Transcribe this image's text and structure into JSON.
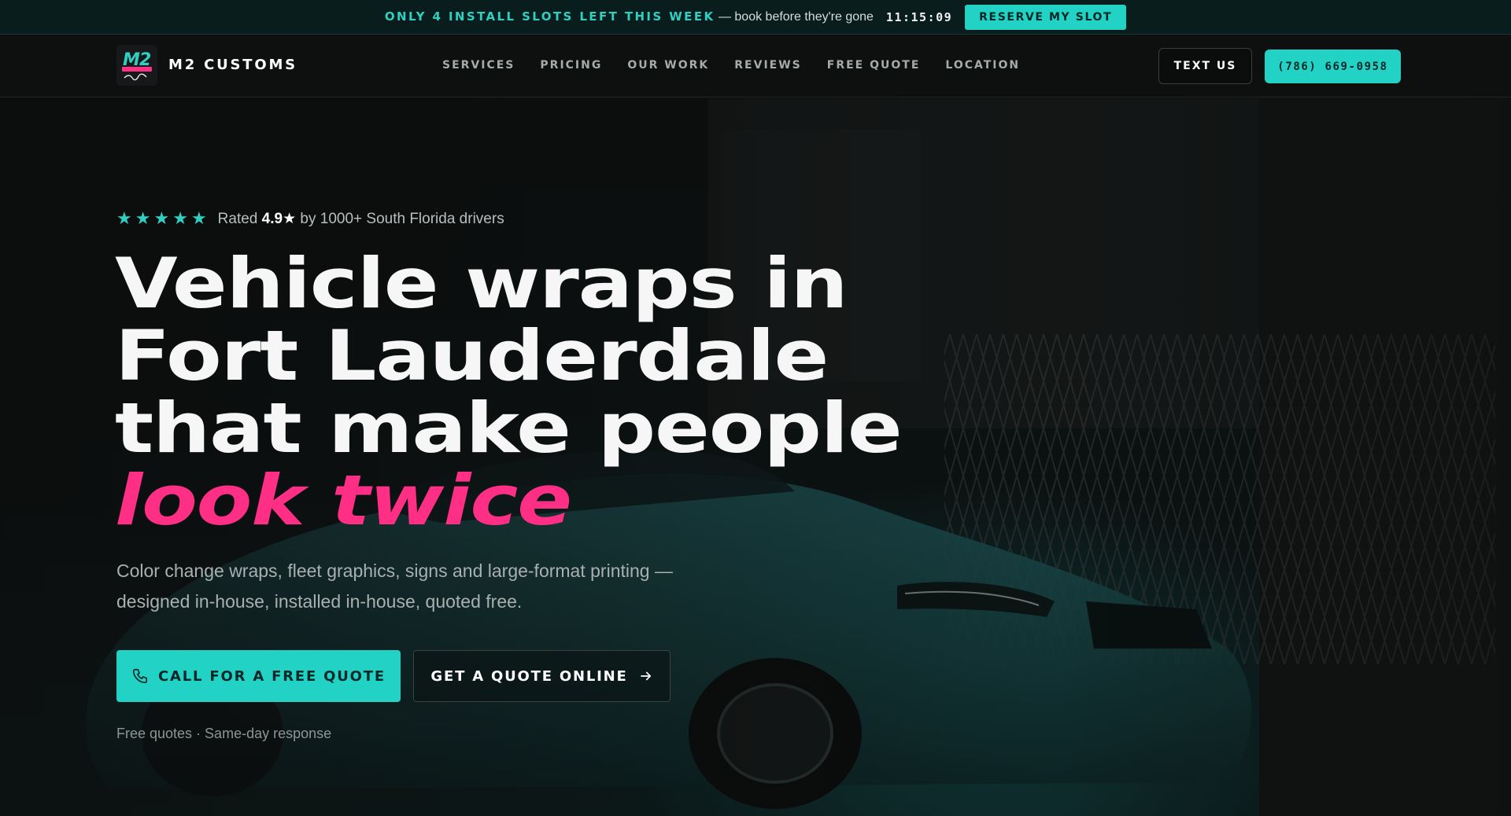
{
  "promo": {
    "headline": "ONLY 4 INSTALL SLOTS LEFT THIS WEEK",
    "subtext": "— book before they're gone",
    "timer": "11:15:09",
    "button_label": "RESERVE MY SLOT"
  },
  "header": {
    "brand": "M2 CUSTOMS",
    "logo_icon": "m2-customs-logo",
    "nav": [
      {
        "label": "SERVICES"
      },
      {
        "label": "PRICING"
      },
      {
        "label": "OUR WORK"
      },
      {
        "label": "REVIEWS"
      },
      {
        "label": "FREE QUOTE"
      },
      {
        "label": "LOCATION"
      }
    ],
    "text_us_label": "TEXT US",
    "phone_label": "(786) 669-0958"
  },
  "hero": {
    "rating": {
      "stars": 5,
      "prefix": "Rated",
      "score": "4.9",
      "score_star": "★",
      "suffix": "by 1000+ South Florida drivers"
    },
    "headline_lines": [
      "Vehicle wraps in",
      "Fort Lauderdale",
      "that make people"
    ],
    "headline_accent": "look twice",
    "subcopy": "Color change wraps, fleet graphics, signs and large-format printing — designed in-house, installed in-house, quoted free.",
    "cta_primary": {
      "label": "CALL FOR A FREE QUOTE",
      "icon": "phone-icon"
    },
    "cta_secondary": {
      "label": "GET A QUOTE ONLINE",
      "icon": "arrow-right-icon"
    },
    "footnote": "Free quotes · Same-day response"
  },
  "colors": {
    "accent": "#22d3c5",
    "highlight": "#ff2f86",
    "background": "#0c0d0d"
  }
}
